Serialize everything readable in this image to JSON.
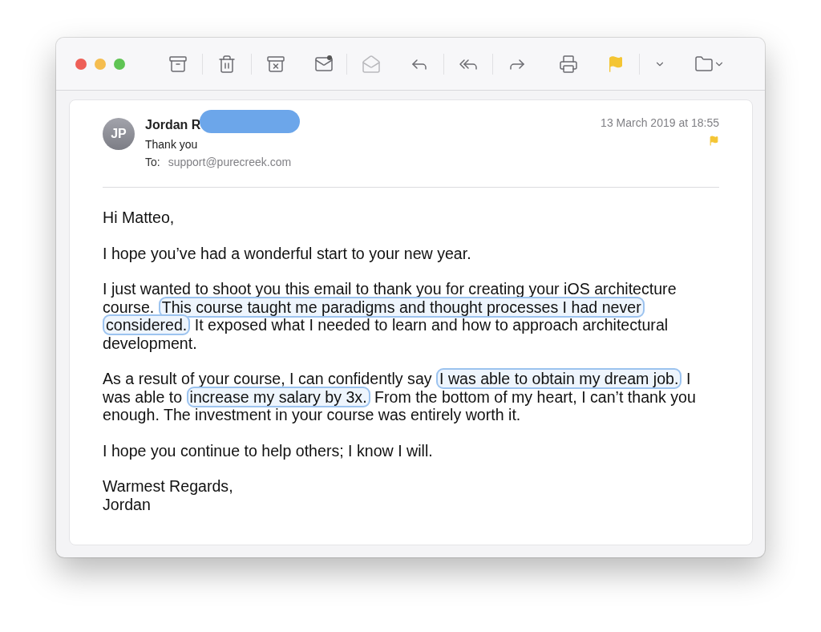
{
  "toolbar": {
    "buttons": [
      {
        "kind": "archive",
        "disabled": false,
        "divider_after": true
      },
      {
        "kind": "trash",
        "disabled": false,
        "divider_after": true
      },
      {
        "kind": "junk",
        "disabled": false,
        "divider_after": false
      },
      {
        "kind": "unread",
        "disabled": false,
        "divider_after": true
      },
      {
        "kind": "read",
        "disabled": true,
        "divider_after": false
      },
      {
        "kind": "reply",
        "disabled": false,
        "divider_after": true
      },
      {
        "kind": "reply-all",
        "disabled": false,
        "divider_after": true
      },
      {
        "kind": "forward",
        "disabled": false,
        "divider_after": false
      },
      {
        "kind": "print",
        "disabled": false,
        "divider_after": false
      },
      {
        "kind": "flag",
        "disabled": false,
        "divider_after": true
      },
      {
        "kind": "flag-menu",
        "disabled": false,
        "divider_after": false
      },
      {
        "kind": "move",
        "disabled": false,
        "divider_after": false
      }
    ]
  },
  "message": {
    "avatar": "JP",
    "sender": "Jordan R",
    "sender_redacted": true,
    "subject": "Thank you",
    "to_label": "To:",
    "to": "support@purecreek.com",
    "date": "13 March 2019 at 18:55",
    "flagged": true,
    "paragraphs": [
      [
        {
          "text": "Hi Matteo,",
          "highlighted": false
        }
      ],
      [
        {
          "text": "I hope you’ve had a wonderful start to your new year.",
          "highlighted": false
        }
      ],
      [
        {
          "text": "I just wanted to shoot you this email to thank you for creating your iOS architecture course. ",
          "highlighted": false
        },
        {
          "text": "This course taught me paradigms and thought processes I had never considered.",
          "highlighted": true
        },
        {
          "text": " It exposed what I needed to learn and how to approach architectural development.",
          "highlighted": false
        }
      ],
      [
        {
          "text": "As a result of your course, I can confidently say ",
          "highlighted": false
        },
        {
          "text": "I was able to obtain my dream job.",
          "highlighted": true
        },
        {
          "text": " I was able to ",
          "highlighted": false
        },
        {
          "text": "increase my salary by 3x.",
          "highlighted": true
        },
        {
          "text": " From the bottom of my heart, I can’t thank you enough. The investment in your course was entirely worth it.",
          "highlighted": false
        }
      ],
      [
        {
          "text": "I hope you continue to help others; I know I will.",
          "highlighted": false
        }
      ],
      [
        {
          "text": "Warmest Regards,",
          "highlighted": false
        },
        {
          "text": "\nJordan",
          "highlighted": false
        }
      ]
    ]
  }
}
